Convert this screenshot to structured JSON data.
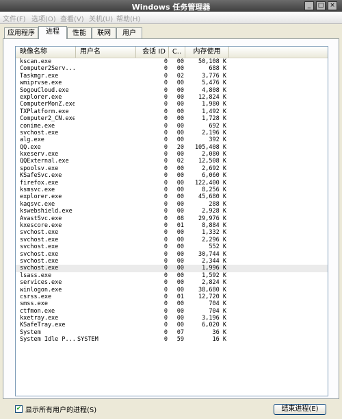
{
  "window": {
    "title": "Windows 任务管理器",
    "minimize": "_",
    "maximize": "□",
    "close": "×"
  },
  "menu": [
    "文件(F)",
    "选项(O)",
    "查看(V)",
    "关机(U)",
    "帮助(H)"
  ],
  "tabs": [
    "应用程序",
    "进程",
    "性能",
    "联网",
    "用户"
  ],
  "active_tab": "进程",
  "columns": {
    "name": "映像名称",
    "user": "用户名",
    "session": "会话 ID",
    "cpu": "C..",
    "mem": "内存使用"
  },
  "processes": [
    {
      "name": "kscan.exe",
      "user": "",
      "session": "0",
      "cpu": "00",
      "mem": "50,108 K"
    },
    {
      "name": "Computer2Serv...",
      "user": "",
      "session": "0",
      "cpu": "00",
      "mem": "688 K"
    },
    {
      "name": "Taskmgr.exe",
      "user": "",
      "session": "0",
      "cpu": "02",
      "mem": "3,776 K"
    },
    {
      "name": "wmiprvse.exe",
      "user": "",
      "session": "0",
      "cpu": "00",
      "mem": "5,476 K"
    },
    {
      "name": "SogouCloud.exe",
      "user": "",
      "session": "0",
      "cpu": "00",
      "mem": "4,808 K"
    },
    {
      "name": "explorer.exe",
      "user": "",
      "session": "0",
      "cpu": "00",
      "mem": "12,824 K"
    },
    {
      "name": "ComputerMonZ.exe",
      "user": "",
      "session": "0",
      "cpu": "00",
      "mem": "1,980 K"
    },
    {
      "name": "TXPlatform.exe",
      "user": "",
      "session": "0",
      "cpu": "00",
      "mem": "1,492 K"
    },
    {
      "name": "Computer2_CN.exe",
      "user": "",
      "session": "0",
      "cpu": "00",
      "mem": "1,728 K"
    },
    {
      "name": "conime.exe",
      "user": "",
      "session": "0",
      "cpu": "00",
      "mem": "692 K"
    },
    {
      "name": "svchost.exe",
      "user": "",
      "session": "0",
      "cpu": "00",
      "mem": "2,196 K"
    },
    {
      "name": "alg.exe",
      "user": "",
      "session": "0",
      "cpu": "00",
      "mem": "392 K"
    },
    {
      "name": "QQ.exe",
      "user": "",
      "session": "0",
      "cpu": "20",
      "mem": "105,408 K"
    },
    {
      "name": "kxeserv.exe",
      "user": "",
      "session": "0",
      "cpu": "00",
      "mem": "2,080 K"
    },
    {
      "name": "QQExternal.exe",
      "user": "",
      "session": "0",
      "cpu": "02",
      "mem": "12,508 K"
    },
    {
      "name": "spoolsv.exe",
      "user": "",
      "session": "0",
      "cpu": "00",
      "mem": "2,692 K"
    },
    {
      "name": "KSafeSvc.exe",
      "user": "",
      "session": "0",
      "cpu": "00",
      "mem": "6,060 K"
    },
    {
      "name": "firefox.exe",
      "user": "",
      "session": "0",
      "cpu": "00",
      "mem": "122,400 K"
    },
    {
      "name": "ksmsvc.exe",
      "user": "",
      "session": "0",
      "cpu": "00",
      "mem": "8,256 K"
    },
    {
      "name": "explorer.exe",
      "user": "",
      "session": "0",
      "cpu": "00",
      "mem": "45,680 K"
    },
    {
      "name": "kaqsvc.exe",
      "user": "",
      "session": "0",
      "cpu": "00",
      "mem": "288 K"
    },
    {
      "name": "kswebshield.exe",
      "user": "",
      "session": "0",
      "cpu": "00",
      "mem": "2,928 K"
    },
    {
      "name": "AvastSvc.exe",
      "user": "",
      "session": "0",
      "cpu": "08",
      "mem": "29,976 K"
    },
    {
      "name": "kxescore.exe",
      "user": "",
      "session": "0",
      "cpu": "01",
      "mem": "8,884 K"
    },
    {
      "name": "svchost.exe",
      "user": "",
      "session": "0",
      "cpu": "00",
      "mem": "1,332 K"
    },
    {
      "name": "svchost.exe",
      "user": "",
      "session": "0",
      "cpu": "00",
      "mem": "2,296 K"
    },
    {
      "name": "svchost.exe",
      "user": "",
      "session": "0",
      "cpu": "00",
      "mem": "552 K"
    },
    {
      "name": "svchost.exe",
      "user": "",
      "session": "0",
      "cpu": "00",
      "mem": "30,744 K"
    },
    {
      "name": "svchost.exe",
      "user": "",
      "session": "0",
      "cpu": "00",
      "mem": "2,344 K"
    },
    {
      "name": "svchost.exe",
      "user": "",
      "session": "0",
      "cpu": "00",
      "mem": "1,996 K",
      "highlight": true
    },
    {
      "name": "lsass.exe",
      "user": "",
      "session": "0",
      "cpu": "00",
      "mem": "1,592 K"
    },
    {
      "name": "services.exe",
      "user": "",
      "session": "0",
      "cpu": "00",
      "mem": "2,824 K"
    },
    {
      "name": "winlogon.exe",
      "user": "",
      "session": "0",
      "cpu": "00",
      "mem": "38,680 K"
    },
    {
      "name": "csrss.exe",
      "user": "",
      "session": "0",
      "cpu": "01",
      "mem": "12,720 K"
    },
    {
      "name": "smss.exe",
      "user": "",
      "session": "0",
      "cpu": "00",
      "mem": "704 K"
    },
    {
      "name": "ctfmon.exe",
      "user": "",
      "session": "0",
      "cpu": "00",
      "mem": "704 K"
    },
    {
      "name": "kxetray.exe",
      "user": "",
      "session": "0",
      "cpu": "00",
      "mem": "3,196 K"
    },
    {
      "name": "KSafeTray.exe",
      "user": "",
      "session": "0",
      "cpu": "00",
      "mem": "6,020 K"
    },
    {
      "name": "System",
      "user": "",
      "session": "0",
      "cpu": "07",
      "mem": "36 K"
    },
    {
      "name": "System Idle P...",
      "user": "SYSTEM",
      "session": "0",
      "cpu": "59",
      "mem": "16 K"
    }
  ],
  "footer": {
    "show_all_label": "显示所有用户的进程(S)",
    "show_all_checked": true,
    "check_mark": "✔",
    "end_process_label": "结束进程(E)"
  },
  "colors": {
    "title_bar": "#4b4b4b",
    "window_bg": "#ece9d8",
    "list_bg": "#ffffff",
    "highlight_row": "#ebebeb",
    "check_mark": "#21a121"
  }
}
